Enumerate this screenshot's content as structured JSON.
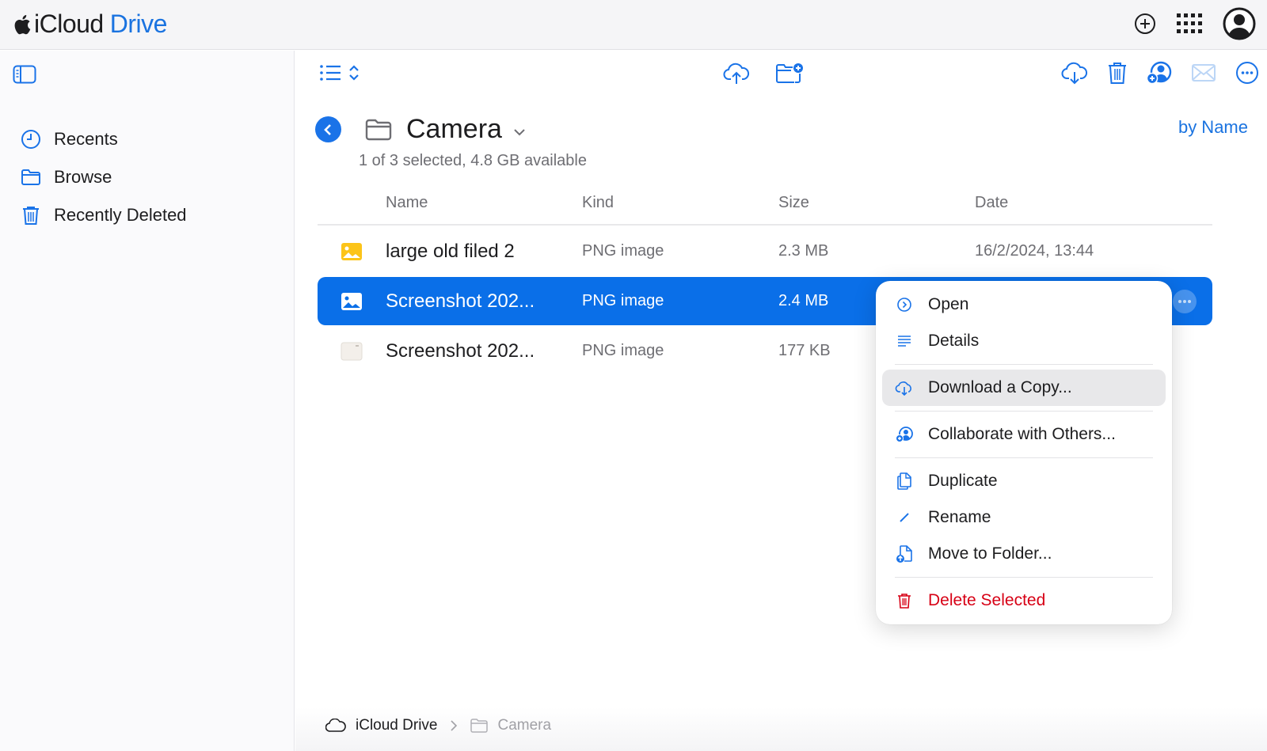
{
  "app": {
    "brand_primary": "iCloud",
    "brand_secondary": "Drive",
    "accent": "#1a73e8",
    "danger": "#d70015"
  },
  "topbar": {
    "icons": [
      "add-circle-icon",
      "app-grid-icon",
      "account-icon"
    ]
  },
  "sidebar": {
    "items": [
      {
        "label": "Recents",
        "icon": "clock-icon"
      },
      {
        "label": "Browse",
        "icon": "folder-icon"
      },
      {
        "label": "Recently Deleted",
        "icon": "trash-icon"
      }
    ]
  },
  "toolbar": {
    "left": [
      "list-view-icon",
      "sort-toggle-icon"
    ],
    "center": [
      "upload-icon",
      "new-folder-icon"
    ],
    "right": [
      "download-icon",
      "trash-icon",
      "share-icon",
      "email-icon",
      "more-icon"
    ]
  },
  "folder": {
    "title": "Camera",
    "subtitle": "1 of 3 selected, 4.8 GB available",
    "sort_label": "by Name"
  },
  "table": {
    "headers": {
      "name": "Name",
      "kind": "Kind",
      "size": "Size",
      "date": "Date"
    },
    "rows": [
      {
        "name": "large old filed 2",
        "kind": "PNG image",
        "size": "2.3 MB",
        "date": "16/2/2024, 13:44",
        "selected": false
      },
      {
        "name": "Screenshot 202...",
        "kind": "PNG image",
        "size": "2.4 MB",
        "date": "",
        "selected": true
      },
      {
        "name": "Screenshot 202...",
        "kind": "PNG image",
        "size": "177 KB",
        "date": "",
        "selected": false
      }
    ]
  },
  "context_menu": {
    "items": [
      {
        "label": "Open",
        "icon": "open-icon"
      },
      {
        "label": "Details",
        "icon": "details-icon"
      },
      {
        "label": "Download a Copy...",
        "icon": "download-icon"
      },
      {
        "label": "Collaborate with Others...",
        "icon": "collaborate-icon"
      },
      {
        "label": "Duplicate",
        "icon": "duplicate-icon"
      },
      {
        "label": "Rename",
        "icon": "rename-icon"
      },
      {
        "label": "Move to Folder...",
        "icon": "move-icon"
      },
      {
        "label": "Delete Selected",
        "icon": "trash-icon"
      }
    ]
  },
  "breadcrumb": {
    "root": "iCloud Drive",
    "current": "Camera"
  }
}
